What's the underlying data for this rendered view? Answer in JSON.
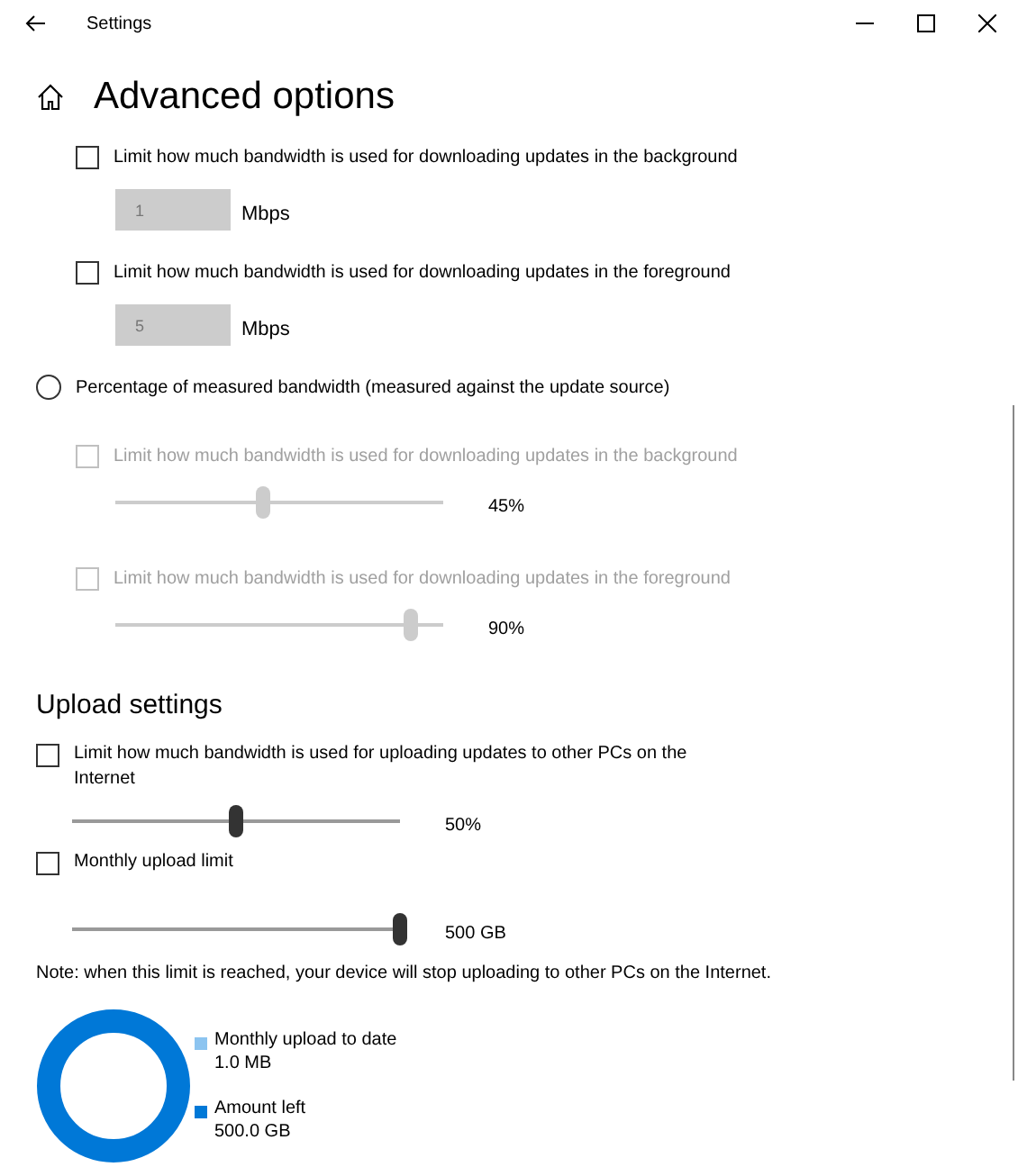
{
  "window": {
    "title": "Settings"
  },
  "page_title": "Advanced options",
  "absolute_limits": [
    {
      "label": "Limit how much bandwidth is used for downloading updates in the background",
      "checked": false,
      "value": "1",
      "disabled": true,
      "unit": "Mbps"
    },
    {
      "label": "Limit how much bandwidth is used for downloading updates in the foreground",
      "checked": false,
      "value": "5",
      "disabled": true,
      "unit": "Mbps"
    }
  ],
  "percentage": {
    "label": "Percentage of measured bandwidth (measured against the update source)",
    "selected": false,
    "limits": [
      {
        "label": "Limit how much bandwidth is used for downloading updates in the background",
        "checked": false,
        "disabled": true,
        "level": 0.45,
        "reading": "45%"
      },
      {
        "label": "Limit how much bandwidth is used for downloading updates in the foreground",
        "checked": false,
        "disabled": true,
        "level": 0.9,
        "reading": "90%"
      }
    ]
  },
  "upload": {
    "title": "Upload settings",
    "items": [
      {
        "label": "Limit how much bandwidth is used for uploading updates to other PCs on the Internet",
        "checked": false,
        "disabled": false,
        "level": 0.5,
        "reading": "50%"
      },
      {
        "label": "Monthly upload limit",
        "checked": false,
        "disabled": false,
        "level": 1.0,
        "reading": "500 GB"
      }
    ],
    "note": "Note: when this limit is reached, your device will stop uploading to other PCs on the Internet.",
    "legend": [
      {
        "label": "Monthly upload to date",
        "value": "1.0 MB",
        "color": "#8cc4f0"
      },
      {
        "label": "Amount left",
        "value": "500.0 GB",
        "color": "#0078d7"
      }
    ]
  }
}
